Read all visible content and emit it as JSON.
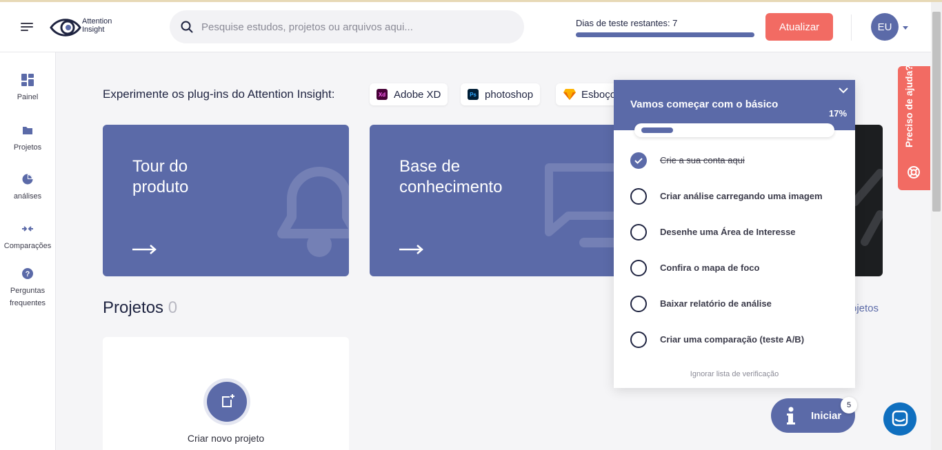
{
  "colors": {
    "brand": "#5b6aa8",
    "accent": "#f26b63",
    "dark_card": "#1c1e20",
    "chat": "#0f6fbf"
  },
  "header": {
    "logo_line1": "Attention",
    "logo_line2": "Insight",
    "search_placeholder": "Pesquise estudos, projetos ou arquivos aqui...",
    "trial_label": "Dias de teste restantes: 7",
    "upgrade_label": "Atualizar",
    "avatar_initials": "EU"
  },
  "sidebar": {
    "items": [
      {
        "label": "Painel",
        "icon": "dashboard-icon"
      },
      {
        "label": "Projetos",
        "icon": "folder-icon"
      },
      {
        "label": "análises",
        "icon": "pie-chart-icon"
      },
      {
        "label": "Comparações",
        "icon": "compare-icon"
      },
      {
        "label": "Perguntas frequentes",
        "icon": "question-icon"
      }
    ]
  },
  "main": {
    "plugins_label": "Experimente os plug-ins do Attention Insight:",
    "plugins": [
      {
        "label": "Adobe XD",
        "badge": "Xd"
      },
      {
        "label": "photoshop",
        "badge": "Ps"
      },
      {
        "label": "Esboço",
        "badge": ""
      }
    ],
    "cards": [
      {
        "title_line1": "Tour do",
        "title_line2": "produto"
      },
      {
        "title_line1": "Base de",
        "title_line2": "conhecimento"
      }
    ],
    "projects_title": "Projetos",
    "projects_count": "0",
    "all_projects_link": "ojetos",
    "new_project_label": "Criar novo projeto"
  },
  "checklist": {
    "title": "Vamos começar com o básico",
    "percent": "17%",
    "progress": 0.17,
    "items": [
      {
        "label": "Crie a sua conta aqui",
        "done": true
      },
      {
        "label": "Criar análise carregando uma imagem",
        "done": false
      },
      {
        "label": "Desenhe uma Área de Interesse",
        "done": false
      },
      {
        "label": "Confira o mapa de foco",
        "done": false
      },
      {
        "label": "Baixar relatório de análise",
        "done": false
      },
      {
        "label": "Criar uma comparação (teste A/B)",
        "done": false
      }
    ],
    "skip_label": "Ignorar lista de verificação"
  },
  "help_tab": {
    "label": "Preciso de ajuda?"
  },
  "launcher": {
    "label": "Iniciar",
    "badge": "5"
  }
}
